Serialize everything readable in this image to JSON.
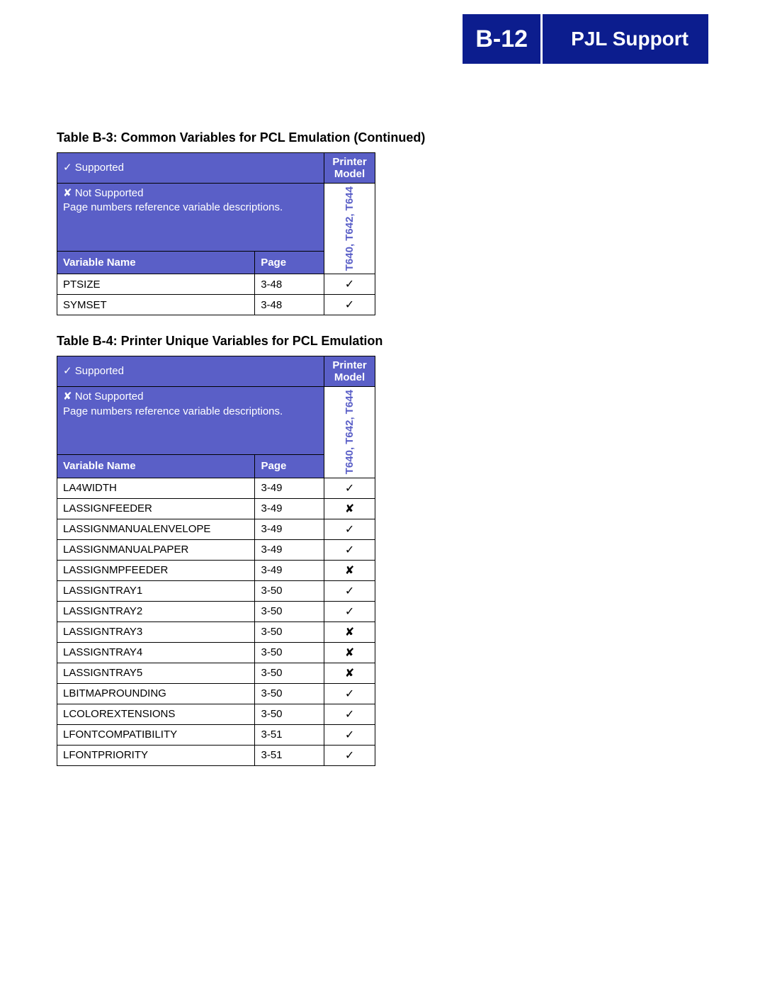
{
  "header": {
    "page_number": "B-12",
    "title": "PJL Support"
  },
  "legend": {
    "supported_mark": "✓",
    "supported_label": "Supported",
    "not_supported_mark": "✘",
    "not_supported_label": "Not Supported",
    "note": "Page numbers reference variable descriptions.",
    "var_header": "Variable Name",
    "page_header": "Page",
    "model_header": "Printer Model",
    "model_column": "T640, T642, T644"
  },
  "table_b3": {
    "caption": "Table B-3:  Common Variables for PCL Emulation (Continued)",
    "rows": [
      {
        "name": "PTSIZE",
        "page": "3-48",
        "mark": "✓"
      },
      {
        "name": "SYMSET",
        "page": "3-48",
        "mark": "✓"
      }
    ]
  },
  "table_b4": {
    "caption": "Table B-4:  Printer Unique Variables for PCL Emulation",
    "rows": [
      {
        "name": "LA4WIDTH",
        "page": "3-49",
        "mark": "✓"
      },
      {
        "name": "LASSIGNFEEDER",
        "page": "3-49",
        "mark": "✘"
      },
      {
        "name": "LASSIGNMANUALENVELOPE",
        "page": "3-49",
        "mark": "✓"
      },
      {
        "name": "LASSIGNMANUALPAPER",
        "page": "3-49",
        "mark": "✓"
      },
      {
        "name": "LASSIGNMPFEEDER",
        "page": "3-49",
        "mark": "✘"
      },
      {
        "name": "LASSIGNTRAY1",
        "page": "3-50",
        "mark": "✓"
      },
      {
        "name": "LASSIGNTRAY2",
        "page": "3-50",
        "mark": "✓"
      },
      {
        "name": "LASSIGNTRAY3",
        "page": "3-50",
        "mark": "✘"
      },
      {
        "name": "LASSIGNTRAY4",
        "page": "3-50",
        "mark": "✘"
      },
      {
        "name": "LASSIGNTRAY5",
        "page": "3-50",
        "mark": "✘"
      },
      {
        "name": "LBITMAPROUNDING",
        "page": "3-50",
        "mark": "✓"
      },
      {
        "name": "LCOLOREXTENSIONS",
        "page": "3-50",
        "mark": "✓"
      },
      {
        "name": "LFONTCOMPATIBILITY",
        "page": "3-51",
        "mark": "✓"
      },
      {
        "name": "LFONTPRIORITY",
        "page": "3-51",
        "mark": "✓"
      }
    ]
  }
}
